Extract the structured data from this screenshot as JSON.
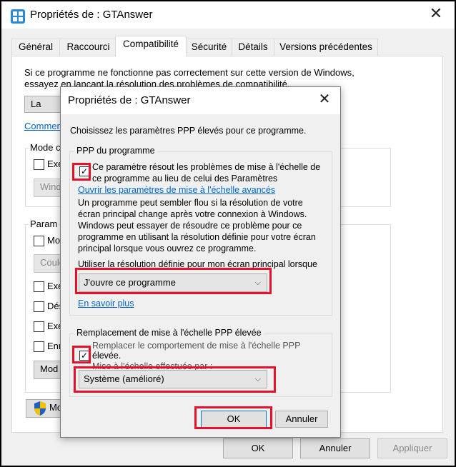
{
  "main_window": {
    "title": "Propriétés de : GTAnswer",
    "close_glyph": "✕",
    "tabs": [
      {
        "label": "Général"
      },
      {
        "label": "Raccourci"
      },
      {
        "label": "Compatibilité"
      },
      {
        "label": "Sécurité"
      },
      {
        "label": "Détails"
      },
      {
        "label": "Versions précédentes"
      }
    ],
    "intro_line1": "Si ce programme ne fonctionne pas correctement sur cette version de Windows,",
    "intro_line2": "essayez en lançant la résolution des problèmes de compatibilité.",
    "run_troubleshooter_button": "La",
    "help_link": "Commen",
    "compat_mode_group": "Mode c",
    "compat_mode_check": "Exé",
    "compat_mode_select": "Windo",
    "settings_group": "Param",
    "settings_items": [
      "Mo",
      "Coule",
      "Exé",
      "Dés",
      "Exé",
      "Enr"
    ],
    "change_dpi_button": "Mod",
    "all_users_button": "Mo",
    "footer": {
      "ok": "OK",
      "cancel": "Annuler",
      "apply": "Appliquer"
    }
  },
  "dialog": {
    "title": "Propriétés de : GTAnswer",
    "close_glyph": "✕",
    "intro": "Choisissez les paramètres PPP élevés pour ce programme.",
    "program_dpi": {
      "group_label": "PPP du programme",
      "checkbox_checked": true,
      "check_glyph": "✓",
      "checkbox_line1": "Ce paramètre résout les problèmes de mise à l'échelle de",
      "checkbox_line2": "ce programme au lieu de celui des Paramètres",
      "advanced_link": "Ouvrir les paramètres de mise à l'échelle avancés",
      "desc_lines": [
        "Un programme peut sembler flou si la résolution de votre",
        "écran principal change après votre connexion à Windows.",
        "Windows peut essayer de résoudre ce problème pour ce",
        "programme en utilisant la résolution définie pour votre écran",
        "principal lorsque vous ouvrez ce programme."
      ],
      "select_label": "Utiliser la résolution définie pour mon écran principal lorsque",
      "select_value": "J'ouvre ce programme",
      "learn_more_link": "En savoir plus"
    },
    "override": {
      "group_label": "Remplacement de mise à l'échelle PPP élevée",
      "checkbox_checked": true,
      "check_glyph": "✓",
      "checkbox_line1": "Remplacer le comportement de mise à l'échelle PPP",
      "checkbox_line2": "élevée.",
      "sub_label": "Mise à l'échelle effectuée par :",
      "select_value": "Système (amélioré)"
    },
    "ok_button": "OK",
    "cancel_button": "Annuler",
    "chevron_glyph": "⌵"
  },
  "colors": {
    "highlight": "#e8102a",
    "link": "#0066cc",
    "accent": "#0078d7"
  }
}
